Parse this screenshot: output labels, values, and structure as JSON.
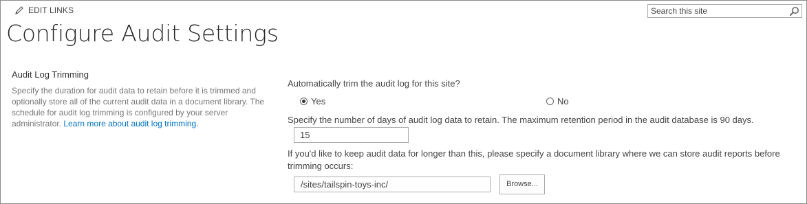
{
  "top_bar": {
    "edit_links_label": "EDIT LINKS",
    "edit_icon": "pencil-icon",
    "search_placeholder": "Search this site",
    "search_value": "",
    "search_icon": "search-icon"
  },
  "page": {
    "title": "Configure Audit Settings"
  },
  "section": {
    "title": "Audit Log Trimming",
    "description": "Specify the duration for audit data to retain before it is trimmed and optionally store all of the current audit data in a document library. The schedule for audit log trimming is configured by your server administrator. ",
    "learn_more_link": "Learn more about audit log trimming."
  },
  "form": {
    "trim_question": "Automatically trim the audit log for this site?",
    "options": [
      {
        "label": "Yes",
        "selected": true
      },
      {
        "label": "No",
        "selected": false
      }
    ],
    "days_label": "Specify the number of days of audit log data to retain. The maximum retention period in the audit database is 90 days.",
    "days_value": "15",
    "library_label": "If you'd like to keep audit data for longer than this, please specify a document library where we can store audit reports before trimming occurs:",
    "library_value": "/sites/tailspin-toys-inc/",
    "browse_label": "Browse..."
  },
  "colors": {
    "link": "#0072c6",
    "title": "#262626",
    "border": "#ababab"
  }
}
